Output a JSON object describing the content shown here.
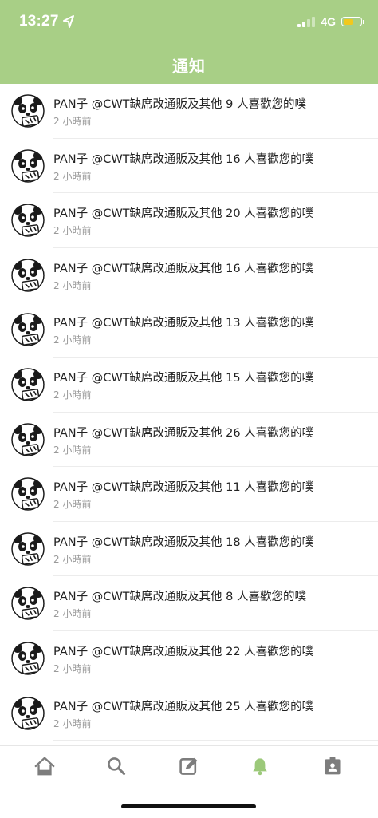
{
  "status_bar": {
    "time": "13:27",
    "network": "4G"
  },
  "header": {
    "title": "通知"
  },
  "notifications": [
    {
      "text": "PAN子 @CWT缺席改通販及其他 9 人喜歡您的噗",
      "time": "2 小時前"
    },
    {
      "text": "PAN子 @CWT缺席改通販及其他 16 人喜歡您的噗",
      "time": "2 小時前"
    },
    {
      "text": "PAN子 @CWT缺席改通販及其他 20 人喜歡您的噗",
      "time": "2 小時前"
    },
    {
      "text": "PAN子 @CWT缺席改通販及其他 16 人喜歡您的噗",
      "time": "2 小時前"
    },
    {
      "text": "PAN子 @CWT缺席改通販及其他 13 人喜歡您的噗",
      "time": "2 小時前"
    },
    {
      "text": "PAN子 @CWT缺席改通販及其他 15 人喜歡您的噗",
      "time": "2 小時前"
    },
    {
      "text": "PAN子 @CWT缺席改通販及其他 26 人喜歡您的噗",
      "time": "2 小時前"
    },
    {
      "text": "PAN子 @CWT缺席改通販及其他 11 人喜歡您的噗",
      "time": "2 小時前"
    },
    {
      "text": "PAN子 @CWT缺席改通販及其他 18 人喜歡您的噗",
      "time": "2 小時前"
    },
    {
      "text": "PAN子 @CWT缺席改通販及其他 8 人喜歡您的噗",
      "time": "2 小時前"
    },
    {
      "text": "PAN子 @CWT缺席改通販及其他 22 人喜歡您的噗",
      "time": "2 小時前"
    },
    {
      "text": "PAN子 @CWT缺席改通販及其他 25 人喜歡您的噗",
      "time": "2 小時前"
    }
  ],
  "tabbar": {
    "items": [
      {
        "icon": "home-icon",
        "active": false
      },
      {
        "icon": "search-icon",
        "active": false
      },
      {
        "icon": "compose-icon",
        "active": false
      },
      {
        "icon": "bell-icon",
        "active": true
      },
      {
        "icon": "profile-card-icon",
        "active": false
      }
    ],
    "active_color": "#9cc97a",
    "inactive_color": "#7d7d7d"
  },
  "colors": {
    "header_bg": "#a8cf86",
    "battery": "#f2c81e"
  }
}
